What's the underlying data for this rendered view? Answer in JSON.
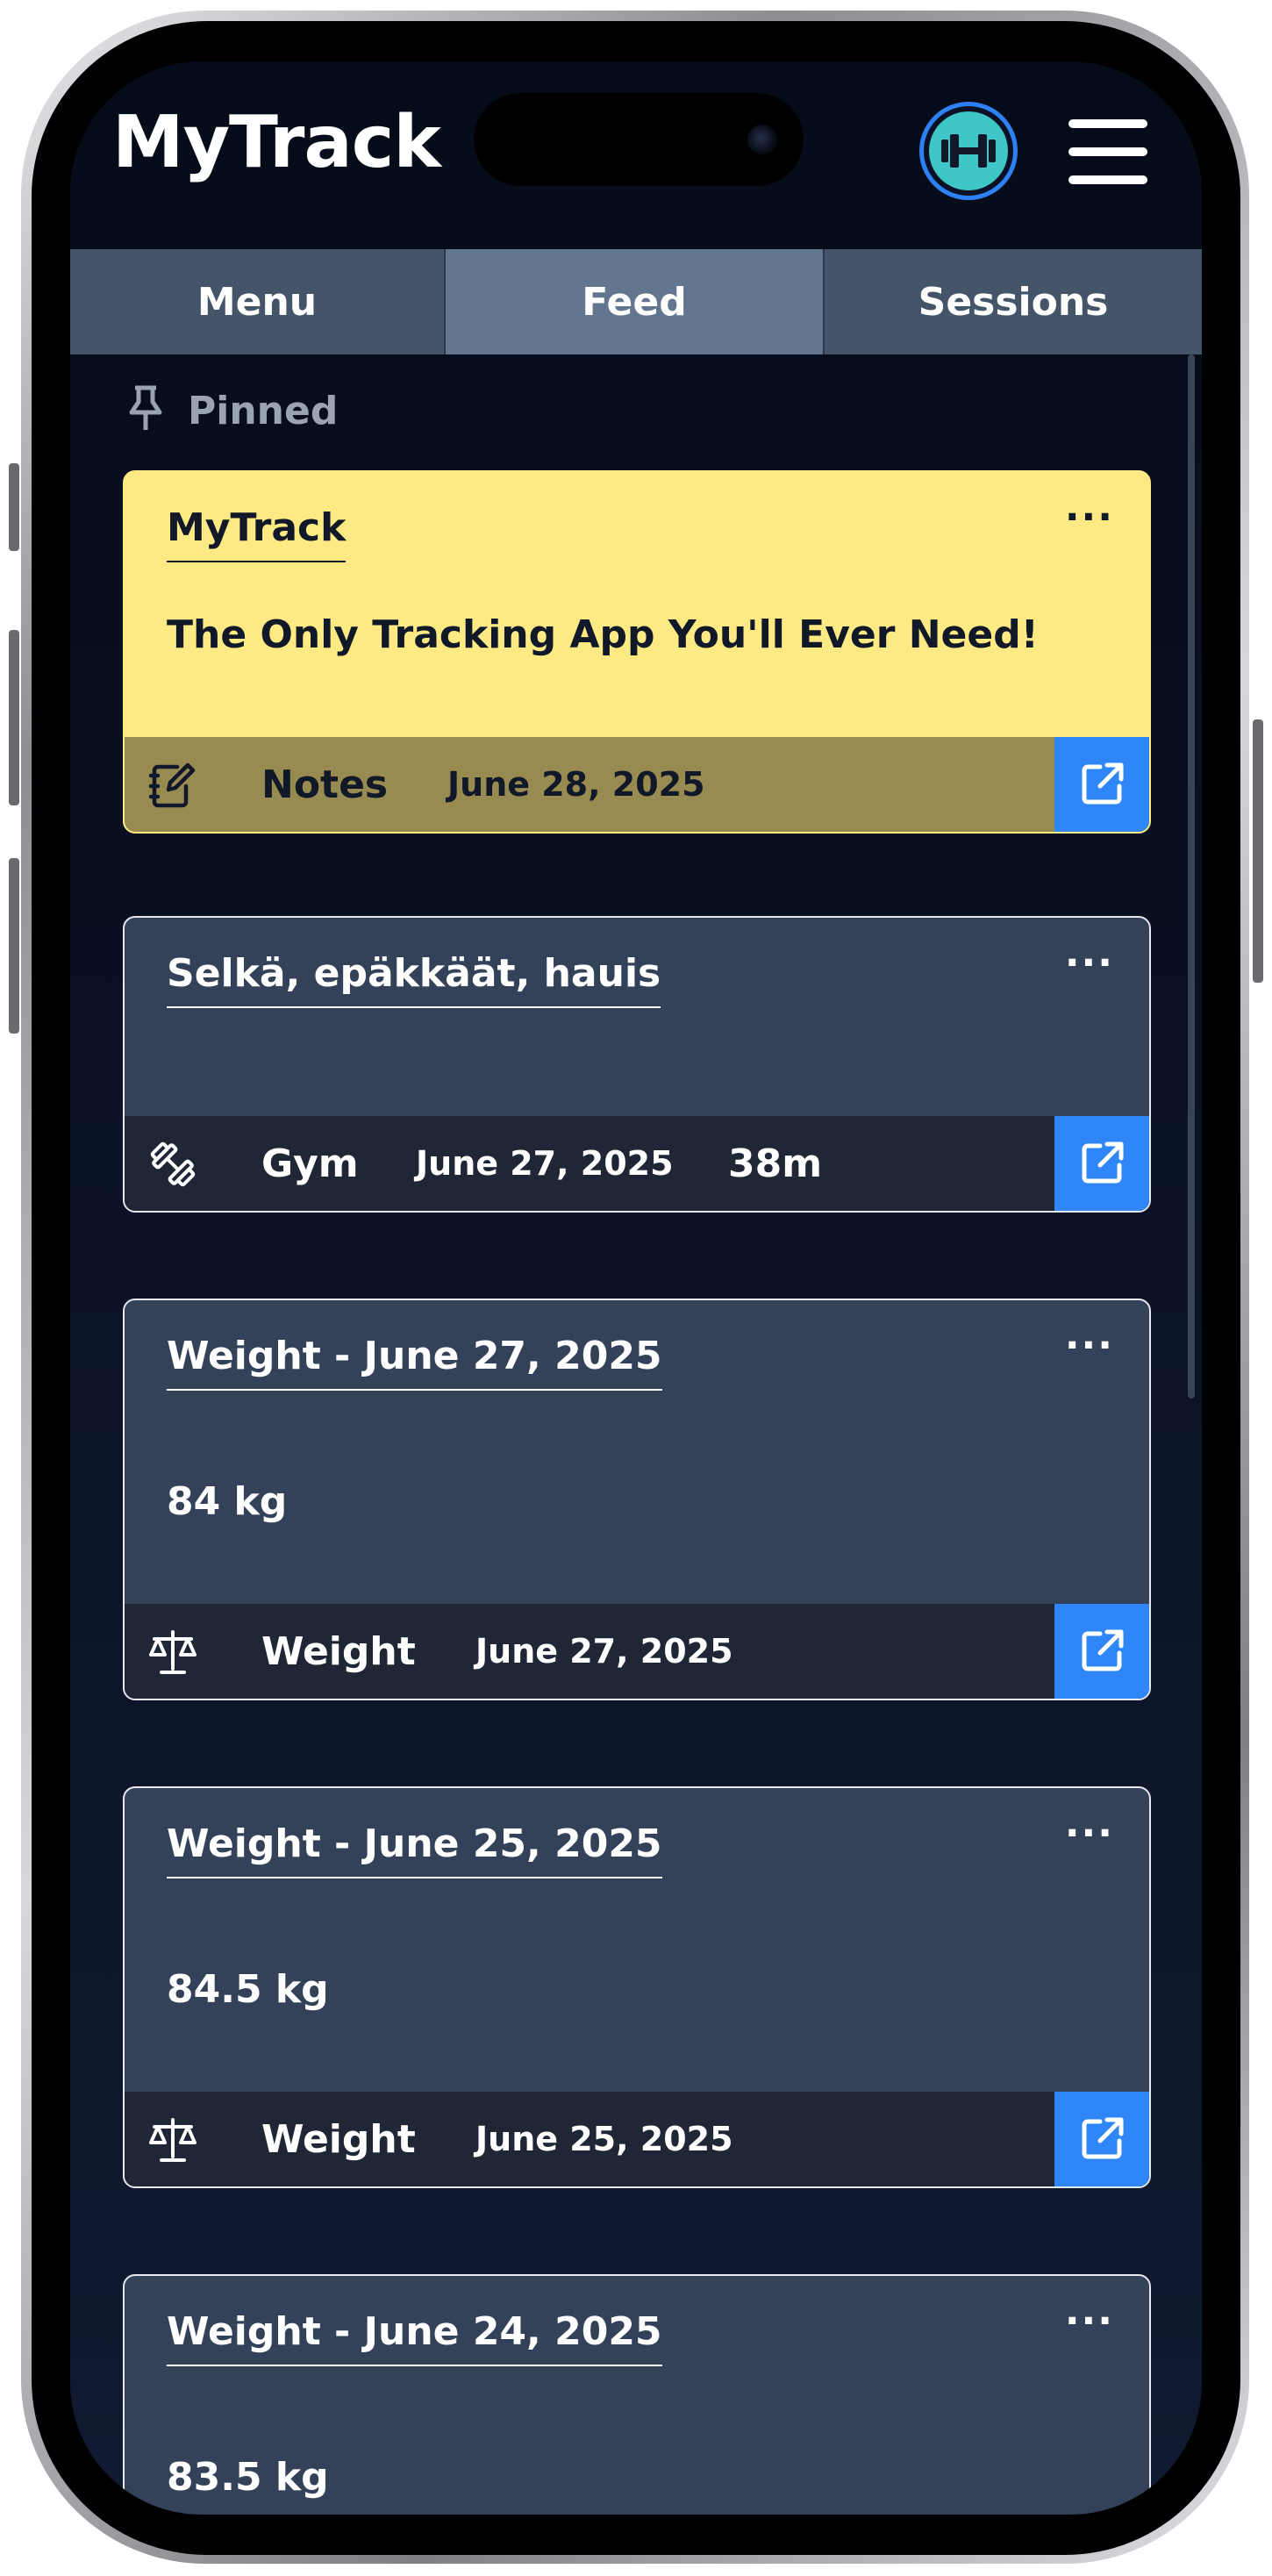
{
  "app": {
    "title": "MyTrack"
  },
  "tabs": [
    {
      "label": "Menu"
    },
    {
      "label": "Feed",
      "active": true
    },
    {
      "label": "Sessions"
    }
  ],
  "pinned": {
    "label": "Pinned"
  },
  "cards": [
    {
      "title": "MyTrack",
      "body": "The Only Tracking App You'll Ever Need!",
      "category": "Notes",
      "date": "June 28, 2025",
      "icon": "notes-icon",
      "more": "···"
    },
    {
      "title": "Selkä, epäkkäät, hauis",
      "body": "",
      "category": "Gym",
      "date": "June 27, 2025",
      "duration": "38m",
      "icon": "dumbbell-icon",
      "more": "···"
    },
    {
      "title": "Weight - June 27, 2025",
      "body": "84 kg",
      "category": "Weight",
      "date": "June 27, 2025",
      "icon": "scale-icon",
      "more": "···"
    },
    {
      "title": "Weight - June 25, 2025",
      "body": "84.5 kg",
      "category": "Weight",
      "date": "June 25, 2025",
      "icon": "scale-icon",
      "more": "···"
    },
    {
      "title": "Weight - June 24, 2025",
      "body": "83.5 kg",
      "more": "···"
    }
  ],
  "colors": {
    "accent": "#2f86f6",
    "avatar_bg": "#3ec7c6",
    "note_card": "#fdea85",
    "card_bg": "#334259"
  }
}
